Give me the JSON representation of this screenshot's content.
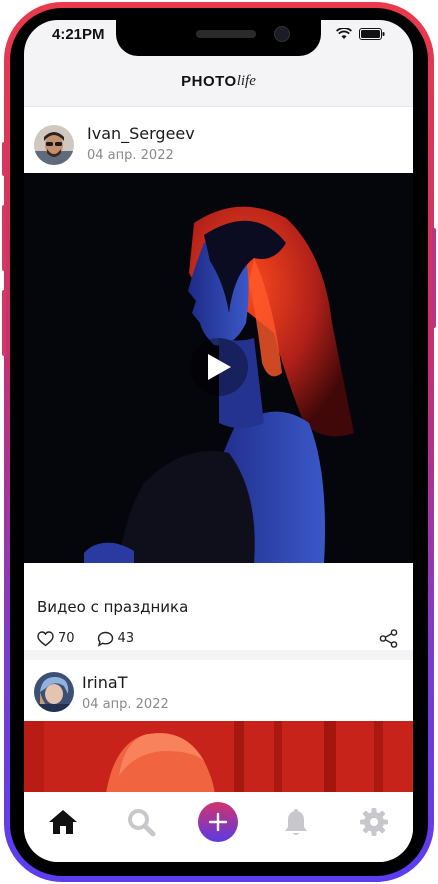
{
  "status": {
    "time": "4:21PM"
  },
  "app": {
    "logo_bold": "PHOTO",
    "logo_italic": "life"
  },
  "posts": [
    {
      "username": "Ivan_Sergeev",
      "date": "04 апр. 2022",
      "caption": "Видео с праздника",
      "likes": "70",
      "comments": "43",
      "is_video": true
    },
    {
      "username": "IrinaT",
      "date": "04 апр. 2022"
    }
  ],
  "tabbar": [
    "home-icon",
    "search-icon",
    "add-icon",
    "bell-icon",
    "gear-icon"
  ],
  "colors": {
    "frame_top": "#ea3a4c",
    "frame_bottom": "#5b3df0",
    "accent_start": "#d2336b",
    "accent_end": "#5a3ae4",
    "tab_inactive": "#c8c8cc"
  }
}
